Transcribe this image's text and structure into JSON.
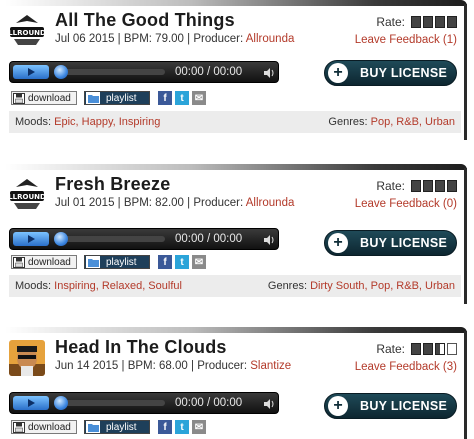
{
  "tracks": [
    {
      "title": "All The Good Things",
      "date": "Jul 06 2015",
      "bpm_label": "BPM: 79.00",
      "producer_label": "Producer:",
      "producer": "Allrounda",
      "rate_label": "Rate:",
      "rating_boxes": [
        "full",
        "full",
        "full",
        "full"
      ],
      "feedback": "Leave Feedback (1)",
      "time": "00:00 / 00:00",
      "buy_label": "BUY LICENSE",
      "download_label": "download",
      "playlist_label": "playlist",
      "moods_label": "Moods:",
      "moods": "Epic, Happy, Inspiring",
      "genres_label": "Genres:",
      "genres": "Pop, R&B, Urban",
      "logo": "allrounda-logo"
    },
    {
      "title": "Fresh Breeze",
      "date": "Jul 01 2015",
      "bpm_label": "BPM: 82.00",
      "producer_label": "Producer:",
      "producer": "Allrounda",
      "rate_label": "Rate:",
      "rating_boxes": [
        "full",
        "full",
        "full",
        "full"
      ],
      "feedback": "Leave Feedback (0)",
      "time": "00:00 / 00:00",
      "buy_label": "BUY LICENSE",
      "download_label": "download",
      "playlist_label": "playlist",
      "moods_label": "Moods:",
      "moods": "Inspiring, Relaxed, Soulful",
      "genres_label": "Genres:",
      "genres": "Dirty South, Pop, R&B, Urban",
      "logo": "allrounda-logo"
    },
    {
      "title": "Head In The Clouds",
      "date": "Jun 14 2015",
      "bpm_label": "BPM: 68.00",
      "producer_label": "Producer:",
      "producer": "Slantize",
      "rate_label": "Rate:",
      "rating_boxes": [
        "full",
        "full",
        "half",
        "empty"
      ],
      "feedback": "Leave Feedback (3)",
      "time": "00:00 / 00:00",
      "buy_label": "BUY LICENSE",
      "download_label": "download",
      "playlist_label": "playlist",
      "logo": "producer-avatar"
    }
  ],
  "colors": {
    "accent_red": "#b33a2a",
    "buy_button": "#0f2d38",
    "player_blue": "#2a6fc9"
  }
}
